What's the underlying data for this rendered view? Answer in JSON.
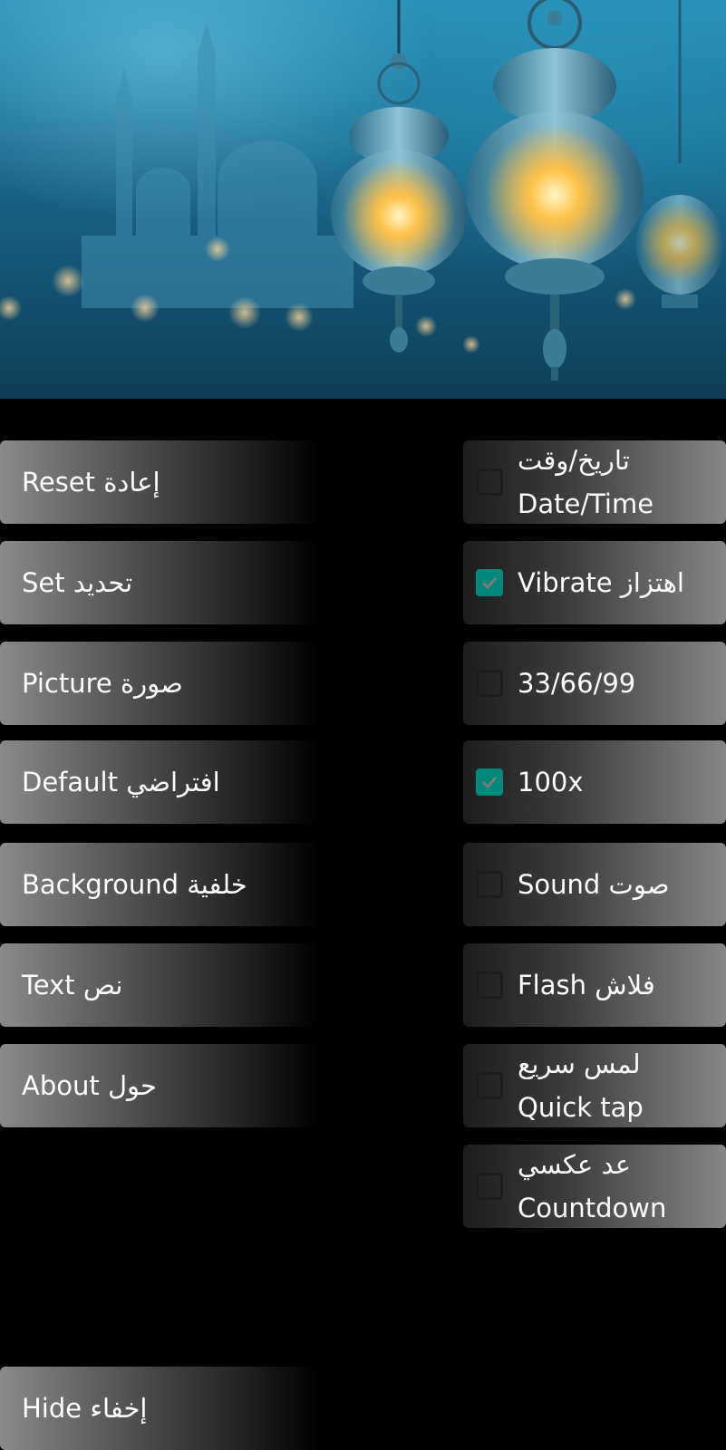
{
  "left_buttons": [
    {
      "label": "Reset إعادة"
    },
    {
      "label": "Set تحديد"
    },
    {
      "label": "Picture صورة"
    },
    {
      "label": "Default افتراضي"
    },
    {
      "label": "Background خلفية"
    },
    {
      "label": "Text نص"
    },
    {
      "label": "About حول"
    }
  ],
  "hide_button": {
    "label": "Hide إخفاء"
  },
  "options": [
    {
      "line1": "تاريخ/وقت",
      "line2": "Date/Time",
      "checked": false
    },
    {
      "label": "Vibrate اهتزاز",
      "checked": true
    },
    {
      "label": "33/66/99",
      "checked": false
    },
    {
      "label": "100x",
      "checked": true
    },
    {
      "label": "Sound صوت",
      "checked": false
    },
    {
      "label": "Flash فلاش",
      "checked": false
    },
    {
      "line1": "لمس سريع",
      "line2": "Quick tap",
      "checked": false
    },
    {
      "line1": "عد عكسي",
      "line2": "Countdown",
      "checked": false
    }
  ],
  "colors": {
    "checkbox_checked": "#00897b",
    "background": "#000000"
  }
}
